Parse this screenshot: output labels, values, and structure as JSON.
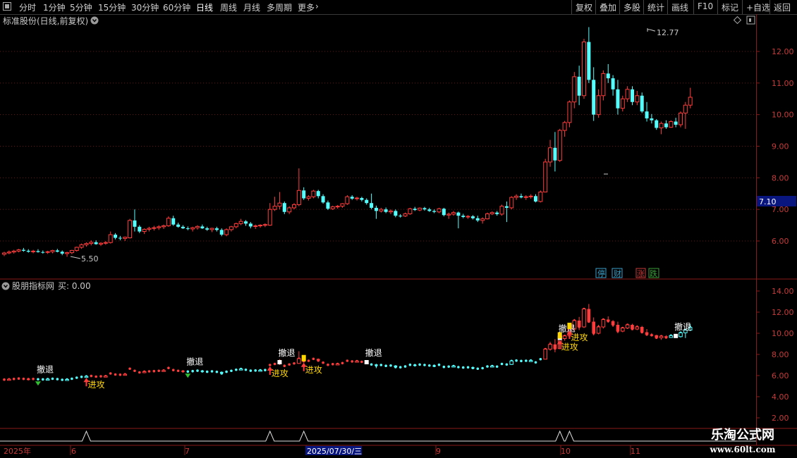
{
  "toolbar": {
    "left_items": [
      "分时",
      "1分钟",
      "5分钟",
      "15分钟",
      "30分钟",
      "60分钟",
      "日线",
      "周线",
      "月线",
      "多周期",
      "更多"
    ],
    "active": "日线",
    "right_items": [
      "复权",
      "叠加",
      "多股",
      "统计",
      "画线",
      "F10",
      "标记",
      "+自选",
      "返回"
    ]
  },
  "main_panel": {
    "title": "标准股份(日线,前复权)",
    "y_labels": [
      "12.00",
      "11.00",
      "10.00",
      "9.00",
      "8.00",
      "7.00",
      "6.00"
    ],
    "y_ticks": [
      12,
      11,
      10,
      9,
      8,
      7,
      6
    ],
    "price_tag": "7.10",
    "high_label": "12.77",
    "low_label": "5.50",
    "event_icons": [
      "停",
      "财",
      "涨",
      "跌"
    ],
    "event_icon_colors": [
      "#3aa0c8",
      "#3aa0c8",
      "#c83a3a",
      "#3aa03a"
    ]
  },
  "ind_panel": {
    "title": "股朋指标网",
    "buy_label": "买: 0.00",
    "y_labels": [
      "14.00",
      "12.00",
      "10.00",
      "8.00",
      "6.00",
      "4.00",
      "2.00"
    ],
    "y_ticks": [
      14,
      12,
      10,
      8,
      6,
      4,
      2
    ],
    "signal_attack": "进攻",
    "signal_retreat": "撤退"
  },
  "time_axis": {
    "labels": [
      "2025年",
      "6",
      "7",
      "2025/07/30/三",
      "9",
      "10",
      "11"
    ]
  },
  "logo": {
    "line1": "乐淘公式网",
    "line2": "www.60lt.com"
  },
  "chart_data": {
    "type": "candlestick",
    "title": "标准股份(日线,前复权)",
    "ylim": [
      5.05,
      13.4
    ],
    "last_price": 7.1,
    "max": 12.77,
    "min": 5.5,
    "ohlc": [
      [
        5.58,
        5.66,
        5.52,
        5.62
      ],
      [
        5.62,
        5.7,
        5.58,
        5.65
      ],
      [
        5.65,
        5.72,
        5.6,
        5.68
      ],
      [
        5.68,
        5.75,
        5.64,
        5.72
      ],
      [
        5.72,
        5.78,
        5.66,
        5.69
      ],
      [
        5.69,
        5.74,
        5.63,
        5.66
      ],
      [
        5.66,
        5.72,
        5.61,
        5.68
      ],
      [
        5.68,
        5.74,
        5.63,
        5.65
      ],
      [
        5.65,
        5.7,
        5.6,
        5.64
      ],
      [
        5.64,
        5.69,
        5.59,
        5.66
      ],
      [
        5.66,
        5.72,
        5.61,
        5.7
      ],
      [
        5.7,
        5.75,
        5.64,
        5.66
      ],
      [
        5.66,
        5.7,
        5.55,
        5.6
      ],
      [
        5.6,
        5.66,
        5.5,
        5.63
      ],
      [
        5.63,
        5.72,
        5.58,
        5.7
      ],
      [
        5.7,
        5.82,
        5.66,
        5.8
      ],
      [
        5.8,
        5.92,
        5.75,
        5.88
      ],
      [
        5.88,
        5.96,
        5.82,
        5.92
      ],
      [
        5.92,
        6.02,
        5.86,
        5.96
      ],
      [
        5.96,
        6.02,
        5.88,
        5.9
      ],
      [
        5.9,
        5.96,
        5.84,
        5.93
      ],
      [
        5.93,
        6.0,
        5.88,
        5.95
      ],
      [
        5.95,
        6.3,
        5.92,
        6.2
      ],
      [
        6.2,
        6.25,
        6.05,
        6.1
      ],
      [
        6.1,
        6.16,
        6.02,
        6.08
      ],
      [
        6.08,
        6.14,
        6.0,
        6.12
      ],
      [
        6.1,
        6.7,
        6.08,
        6.65
      ],
      [
        6.65,
        7.0,
        6.3,
        6.45
      ],
      [
        6.45,
        6.5,
        6.25,
        6.3
      ],
      [
        6.3,
        6.4,
        6.22,
        6.37
      ],
      [
        6.37,
        6.45,
        6.3,
        6.4
      ],
      [
        6.4,
        6.48,
        6.33,
        6.42
      ],
      [
        6.42,
        6.5,
        6.35,
        6.45
      ],
      [
        6.45,
        6.52,
        6.38,
        6.48
      ],
      [
        6.48,
        6.78,
        6.45,
        6.72
      ],
      [
        6.72,
        6.8,
        6.48,
        6.52
      ],
      [
        6.52,
        6.58,
        6.42,
        6.45
      ],
      [
        6.45,
        6.5,
        6.38,
        6.4
      ],
      [
        6.4,
        6.46,
        6.34,
        6.38
      ],
      [
        6.38,
        6.45,
        6.3,
        6.42
      ],
      [
        6.42,
        6.5,
        6.36,
        6.46
      ],
      [
        6.46,
        6.52,
        6.38,
        6.4
      ],
      [
        6.4,
        6.45,
        6.32,
        6.36
      ],
      [
        6.36,
        6.42,
        6.28,
        6.4
      ],
      [
        6.4,
        6.45,
        6.3,
        6.35
      ],
      [
        6.35,
        6.4,
        6.15,
        6.2
      ],
      [
        6.2,
        6.4,
        6.15,
        6.36
      ],
      [
        6.36,
        6.48,
        6.3,
        6.45
      ],
      [
        6.45,
        6.58,
        6.4,
        6.55
      ],
      [
        6.55,
        6.7,
        6.5,
        6.62
      ],
      [
        6.62,
        6.66,
        6.48,
        6.55
      ],
      [
        6.55,
        6.6,
        6.4,
        6.46
      ],
      [
        6.46,
        6.52,
        6.38,
        6.48
      ],
      [
        6.48,
        6.53,
        6.42,
        6.5
      ],
      [
        6.5,
        6.56,
        6.44,
        6.52
      ],
      [
        6.5,
        7.2,
        6.48,
        7.0
      ],
      [
        7.0,
        7.4,
        6.95,
        7.1
      ],
      [
        7.1,
        7.55,
        7.0,
        7.2
      ],
      [
        7.2,
        7.25,
        6.85,
        6.92
      ],
      [
        6.92,
        7.1,
        6.85,
        7.05
      ],
      [
        7.05,
        7.2,
        7.0,
        7.15
      ],
      [
        7.15,
        8.3,
        7.1,
        7.6
      ],
      [
        7.6,
        7.7,
        7.3,
        7.35
      ],
      [
        7.35,
        7.45,
        7.28,
        7.4
      ],
      [
        7.4,
        7.62,
        7.35,
        7.58
      ],
      [
        7.58,
        7.62,
        7.35,
        7.42
      ],
      [
        7.42,
        7.48,
        7.18,
        7.22
      ],
      [
        7.22,
        7.28,
        6.98,
        7.02
      ],
      [
        7.02,
        7.12,
        6.98,
        7.08
      ],
      [
        7.08,
        7.14,
        7.02,
        7.1
      ],
      [
        7.1,
        7.2,
        7.05,
        7.18
      ],
      [
        7.18,
        7.45,
        7.14,
        7.4
      ],
      [
        7.4,
        7.45,
        7.3,
        7.34
      ],
      [
        7.34,
        7.4,
        7.28,
        7.36
      ],
      [
        7.36,
        7.4,
        7.25,
        7.3
      ],
      [
        7.3,
        7.35,
        7.15,
        7.2
      ],
      [
        7.2,
        7.5,
        7.0,
        7.05
      ],
      [
        7.05,
        7.12,
        6.7,
        6.95
      ],
      [
        6.95,
        7.05,
        6.9,
        7.0
      ],
      [
        7.0,
        7.06,
        6.88,
        6.92
      ],
      [
        6.92,
        7.0,
        6.85,
        6.95
      ],
      [
        6.95,
        7.0,
        6.75,
        6.8
      ],
      [
        6.8,
        6.85,
        6.74,
        6.79
      ],
      [
        6.79,
        6.9,
        6.76,
        6.86
      ],
      [
        6.86,
        7.05,
        6.83,
        7.02
      ],
      [
        7.02,
        7.08,
        6.95,
        6.98
      ],
      [
        6.98,
        7.06,
        6.94,
        7.04
      ],
      [
        7.04,
        7.08,
        6.96,
        7.0
      ],
      [
        7.0,
        7.05,
        6.92,
        6.95
      ],
      [
        6.95,
        7.0,
        6.88,
        6.92
      ],
      [
        6.92,
        7.05,
        6.88,
        7.02
      ],
      [
        7.02,
        7.05,
        6.78,
        6.82
      ],
      [
        6.82,
        6.9,
        6.7,
        6.85
      ],
      [
        6.85,
        6.95,
        6.8,
        6.9
      ],
      [
        6.9,
        6.93,
        6.4,
        6.8
      ],
      [
        6.8,
        6.86,
        6.72,
        6.76
      ],
      [
        6.76,
        6.82,
        6.7,
        6.78
      ],
      [
        6.78,
        6.82,
        6.68,
        6.72
      ],
      [
        6.72,
        6.8,
        6.6,
        6.65
      ],
      [
        6.65,
        6.75,
        6.55,
        6.7
      ],
      [
        6.7,
        6.9,
        6.68,
        6.86
      ],
      [
        6.86,
        6.94,
        6.82,
        6.9
      ],
      [
        6.9,
        6.95,
        6.8,
        6.85
      ],
      [
        6.85,
        7.15,
        6.8,
        7.1
      ],
      [
        7.1,
        7.25,
        6.6,
        7.05
      ],
      [
        7.05,
        7.42,
        7.0,
        7.38
      ],
      [
        7.38,
        7.48,
        7.3,
        7.42
      ],
      [
        7.42,
        7.5,
        7.35,
        7.38
      ],
      [
        7.38,
        7.45,
        7.3,
        7.4
      ],
      [
        7.4,
        7.48,
        7.34,
        7.42
      ],
      [
        7.42,
        7.48,
        7.22,
        7.25
      ],
      [
        7.25,
        7.6,
        7.22,
        7.55
      ],
      [
        7.55,
        8.6,
        7.95,
        8.5
      ],
      [
        8.5,
        9.2,
        8.35,
        8.95
      ],
      [
        8.95,
        9.45,
        8.2,
        8.55
      ],
      [
        8.55,
        9.55,
        8.5,
        9.5
      ],
      [
        9.5,
        9.8,
        9.3,
        9.75
      ],
      [
        9.75,
        10.45,
        9.6,
        10.4
      ],
      [
        10.4,
        11.35,
        10.2,
        11.2
      ],
      [
        11.2,
        11.55,
        10.3,
        10.6
      ],
      [
        10.6,
        12.4,
        10.5,
        12.3
      ],
      [
        12.3,
        12.77,
        11.0,
        11.1
      ],
      [
        11.1,
        11.5,
        9.8,
        10.0
      ],
      [
        10.0,
        10.8,
        9.9,
        10.6
      ],
      [
        10.6,
        11.4,
        10.45,
        11.3
      ],
      [
        11.3,
        11.6,
        11.0,
        11.15
      ],
      [
        11.15,
        11.25,
        10.6,
        10.8
      ],
      [
        10.8,
        11.1,
        10.0,
        10.2
      ],
      [
        10.2,
        10.6,
        10.1,
        10.5
      ],
      [
        10.5,
        10.9,
        10.4,
        10.8
      ],
      [
        10.8,
        10.9,
        10.3,
        10.4
      ],
      [
        10.4,
        10.75,
        10.3,
        10.6
      ],
      [
        10.6,
        10.7,
        10.05,
        10.1
      ],
      [
        10.1,
        10.4,
        9.78,
        9.88
      ],
      [
        9.88,
        10.02,
        9.72,
        9.82
      ],
      [
        9.82,
        9.86,
        9.52,
        9.58
      ],
      [
        9.58,
        9.78,
        9.38,
        9.72
      ],
      [
        9.72,
        9.82,
        9.55,
        9.6
      ],
      [
        9.6,
        9.82,
        9.58,
        9.78
      ],
      [
        9.78,
        9.9,
        9.6,
        9.68
      ],
      [
        9.68,
        10.1,
        9.6,
        10.05
      ],
      [
        10.05,
        10.4,
        9.55,
        10.3
      ],
      [
        10.3,
        10.85,
        10.2,
        10.55
      ]
    ]
  }
}
